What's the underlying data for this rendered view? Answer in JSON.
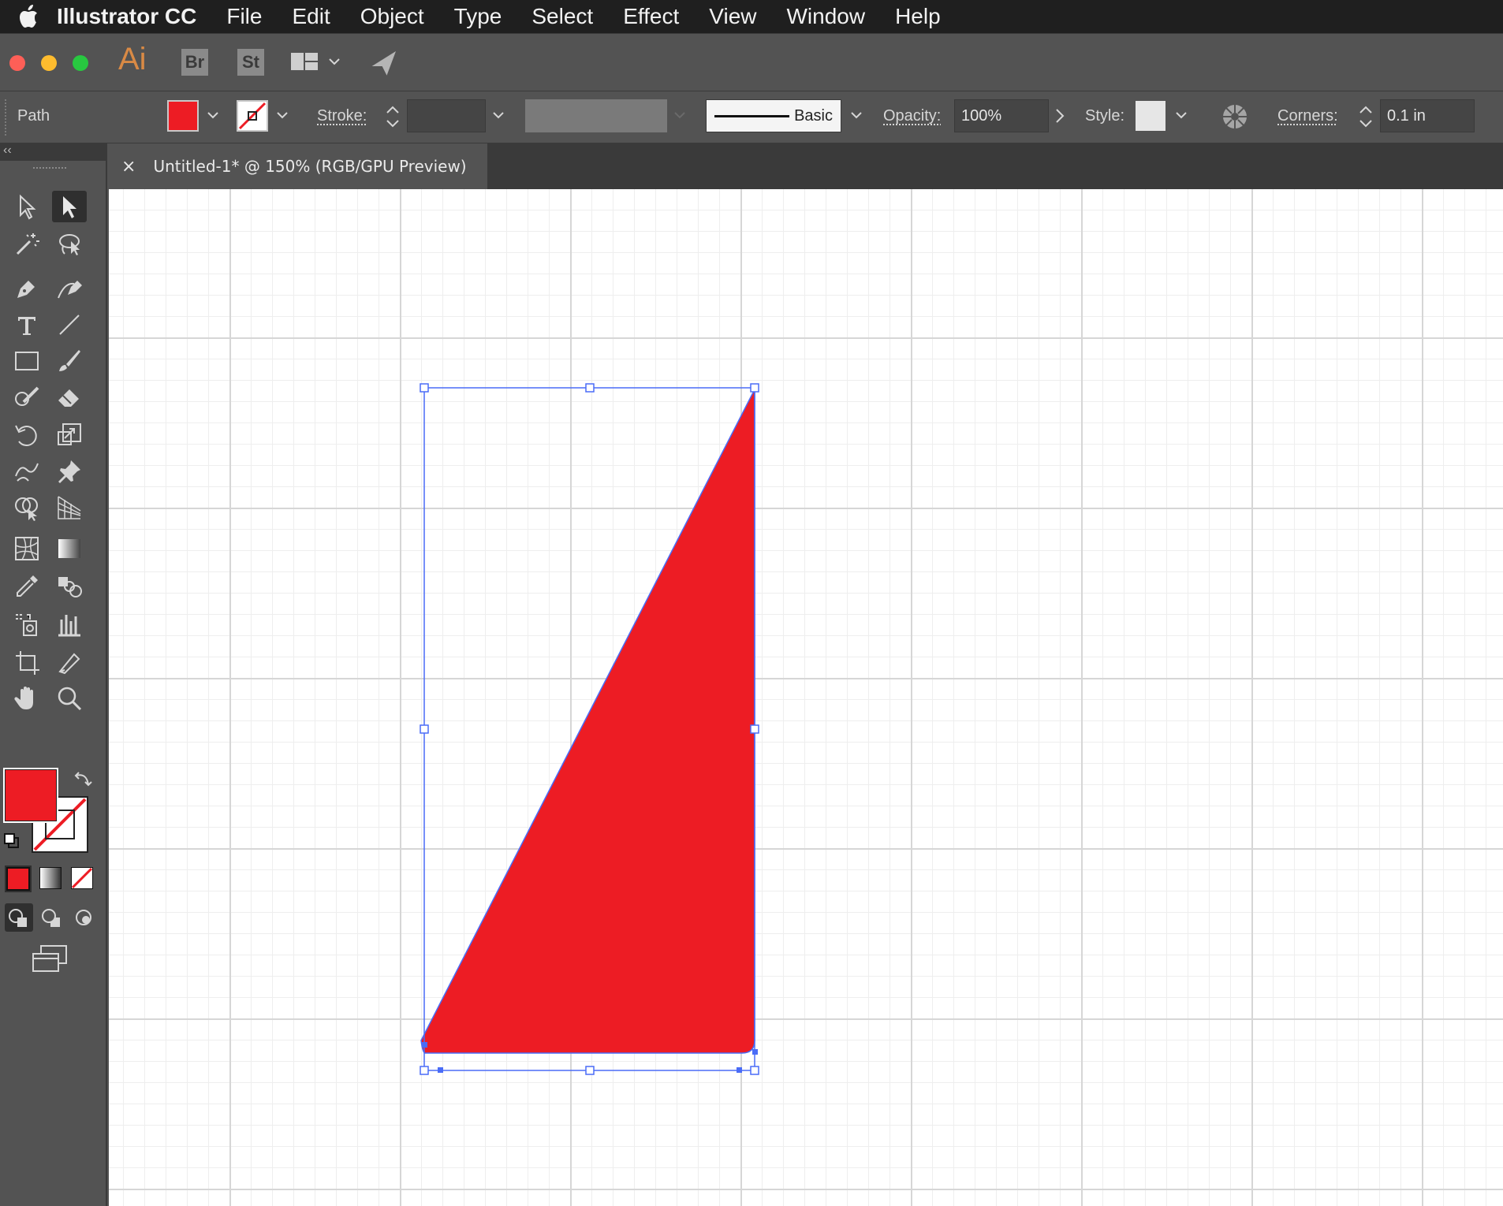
{
  "menubar": {
    "apple_icon": "apple-icon",
    "app_name": "Illustrator CC",
    "items": [
      "File",
      "Edit",
      "Object",
      "Type",
      "Select",
      "Effect",
      "View",
      "Window",
      "Help"
    ]
  },
  "appbar": {
    "logo": "Ai",
    "bridge": "Br",
    "stock": "St"
  },
  "control": {
    "selection_type": "Path",
    "fill_color": "#ed1c24",
    "stroke_color": "none",
    "stroke_label": "Stroke:",
    "stroke_weight": "",
    "brush_style": "Basic",
    "opacity_label": "Opacity:",
    "opacity": "100%",
    "style_label": "Style:",
    "corners_label": "Corners:",
    "corners": "0.1 in"
  },
  "document": {
    "tab_title": "Untitled-1* @ 150% (RGB/GPU Preview)",
    "close_glyph": "×"
  },
  "toolbar": {
    "fill_color": "#ed1c24",
    "stroke_color": "none"
  },
  "colors": {
    "selection": "#4a6cf7",
    "shape_fill": "#ed1c24",
    "ui_dark": "#535353"
  }
}
